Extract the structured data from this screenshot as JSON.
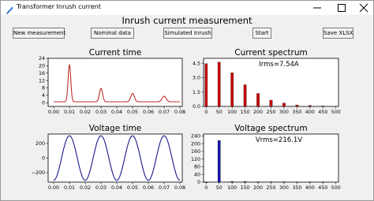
{
  "window": {
    "title": "Transformer Inrush current",
    "minimize_icon": "minimize-icon",
    "maximize_icon": "maximize-icon",
    "close_icon": "close-icon"
  },
  "toolbar": {
    "heading": "Inrush current measurement",
    "new_measurement": "New measurement",
    "nominal_data": "Nominal data",
    "simulated_inrush": "Simulated Inrush",
    "start": "Start",
    "save_xlsx": "Save XLSX"
  },
  "colors": {
    "current": "#c0302c",
    "voltage": "#1a1a8c",
    "spectrum_current": "#cc0000",
    "spectrum_voltage": "#1414b4"
  },
  "chart_data": [
    {
      "type": "line",
      "title": "Current time",
      "xlim": [
        -0.0035,
        0.0815
      ],
      "ylim": [
        -2,
        24
      ],
      "xticks": [
        "0.00",
        "0.01",
        "0.02",
        "0.03",
        "0.04",
        "0.05",
        "0.06",
        "0.07",
        "0.08"
      ],
      "yticks": [
        "0",
        "4",
        "8",
        "12",
        "16",
        "20",
        "24"
      ],
      "pulse_times": [
        0.01,
        0.03,
        0.05,
        0.07
      ],
      "pulse_peaks": [
        20.5,
        7.8,
        5.0,
        3.5
      ],
      "baseline": 0.5,
      "series": [
        {
          "values": "inrush pulses"
        }
      ]
    },
    {
      "type": "bar",
      "title": "Current spectrum",
      "annotation": "Irms=7.54A",
      "xlim": [
        -10,
        510
      ],
      "ylim": [
        0,
        5
      ],
      "xticks": [
        "0",
        "50",
        "100",
        "150",
        "200",
        "250",
        "300",
        "350",
        "400",
        "450",
        "500"
      ],
      "yticks": [
        "0.0",
        "1.5",
        "3.0",
        "4.5"
      ],
      "categories": [
        0,
        50,
        100,
        150,
        200,
        250,
        300,
        350,
        400,
        450
      ],
      "values": [
        4.45,
        4.6,
        3.5,
        2.25,
        1.35,
        0.65,
        0.35,
        0.15,
        0.1,
        0.05
      ]
    },
    {
      "type": "line",
      "title": "Voltage time",
      "xlim": [
        -0.0035,
        0.0815
      ],
      "ylim": [
        -330,
        330
      ],
      "xticks": [
        "0.00",
        "0.01",
        "0.02",
        "0.03",
        "0.04",
        "0.05",
        "0.06",
        "0.07",
        "0.08"
      ],
      "yticks": [
        "−200",
        "0",
        "200"
      ],
      "amplitude": 305,
      "frequency": 50,
      "series": [
        {
          "values": "sine"
        }
      ]
    },
    {
      "type": "bar",
      "title": "Voltage spectrum",
      "annotation": "Vrms=216.1V",
      "xlim": [
        -10,
        510
      ],
      "ylim": [
        0,
        250
      ],
      "xticks": [
        "0",
        "50",
        "100",
        "150",
        "200",
        "250",
        "300",
        "350",
        "400",
        "450",
        "500"
      ],
      "yticks": [
        "0",
        "40",
        "80",
        "120",
        "160",
        "200",
        "240"
      ],
      "categories": [
        0,
        50,
        100,
        150,
        200,
        250,
        300,
        350,
        400,
        450
      ],
      "values": [
        0,
        216,
        3,
        3,
        2,
        2,
        2,
        1,
        1,
        1
      ]
    }
  ]
}
